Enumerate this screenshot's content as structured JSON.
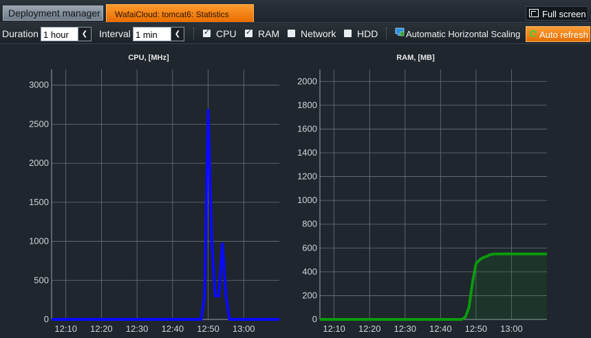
{
  "tabs": {
    "deployment_manager": "Deployment manager",
    "statistics": "WafaiCloud: tomcat6: Statistics"
  },
  "header": {
    "fullscreen_label": "Full screen"
  },
  "toolbar": {
    "duration_label": "Duration",
    "duration_value": "1 hour",
    "interval_label": "Interval",
    "interval_value": "1 min",
    "checkboxes": [
      {
        "label": "CPU",
        "checked": true
      },
      {
        "label": "RAM",
        "checked": true
      },
      {
        "label": "Network",
        "checked": false
      },
      {
        "label": "HDD",
        "checked": false
      }
    ],
    "ahs_label": "Automatic Horizontal Scaling",
    "auto_refresh_label": "Auto refresh",
    "icons": {
      "ahs": "scaling-icon",
      "refresh": "refresh-icon",
      "fullscreen": "fullscreen-icon"
    }
  },
  "chart_data": [
    {
      "type": "line",
      "title": "CPU, [MHz]",
      "xlabel": "",
      "ylabel": "",
      "x_ticks": [
        "12:10",
        "12:20",
        "12:30",
        "12:40",
        "12:50",
        "13:00"
      ],
      "y_ticks": [
        0,
        500,
        1000,
        1500,
        2000,
        2500,
        3000
      ],
      "xlim": [
        "12:06",
        "13:10"
      ],
      "ylim": [
        0,
        3200
      ],
      "grid": true,
      "color": "#0a0aff",
      "fill": false,
      "series": [
        {
          "x": [
            "12:06",
            "12:47",
            "12:48",
            "12:49",
            "12:50",
            "12:51",
            "12:52",
            "12:53",
            "12:54",
            "12:55",
            "12:56",
            "12:57",
            "13:10"
          ],
          "y": [
            0,
            0,
            0,
            300,
            2680,
            1000,
            300,
            300,
            970,
            300,
            0,
            0,
            0
          ]
        }
      ]
    },
    {
      "type": "area",
      "title": "RAM, [MB]",
      "xlabel": "",
      "ylabel": "",
      "x_ticks": [
        "12:10",
        "12:20",
        "12:30",
        "12:40",
        "12:50",
        "13:00"
      ],
      "y_ticks": [
        0,
        200,
        400,
        600,
        800,
        1000,
        1200,
        1400,
        1600,
        1800,
        2000
      ],
      "xlim": [
        "12:06",
        "13:10"
      ],
      "ylim": [
        0,
        2100
      ],
      "grid": true,
      "color": "#0c9a0c",
      "fill": true,
      "series": [
        {
          "x": [
            "12:06",
            "12:46",
            "12:47",
            "12:48",
            "12:49",
            "12:50",
            "12:51",
            "12:52",
            "12:53",
            "12:54",
            "12:55",
            "12:56",
            "13:10"
          ],
          "y": [
            0,
            0,
            20,
            100,
            310,
            470,
            500,
            520,
            530,
            545,
            550,
            550,
            550
          ]
        }
      ]
    }
  ]
}
